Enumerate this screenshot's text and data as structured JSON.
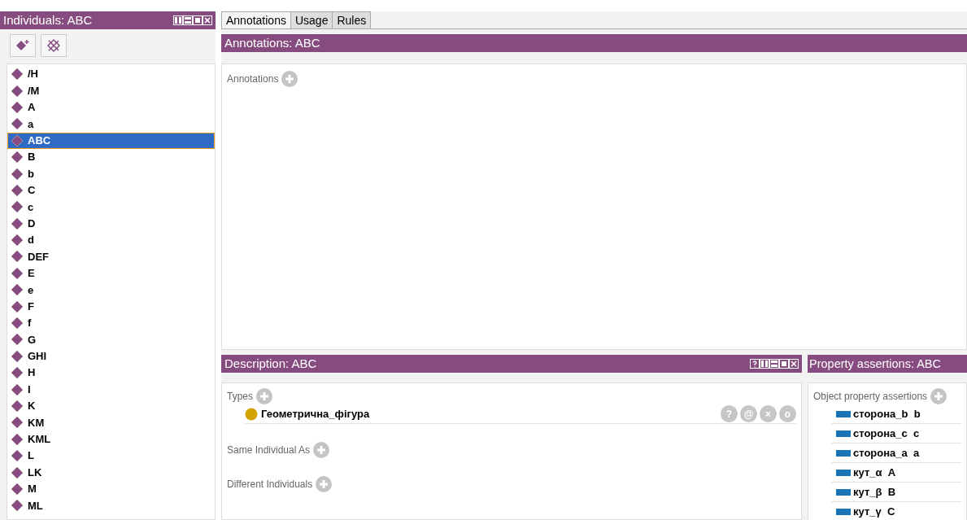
{
  "individuals_panel": {
    "title": "Individuals: ABC",
    "items": [
      {
        "label": "/H",
        "selected": false
      },
      {
        "label": "/M",
        "selected": false
      },
      {
        "label": "A",
        "selected": false
      },
      {
        "label": "a",
        "selected": false
      },
      {
        "label": "ABC",
        "selected": true
      },
      {
        "label": "B",
        "selected": false
      },
      {
        "label": "b",
        "selected": false
      },
      {
        "label": "C",
        "selected": false
      },
      {
        "label": "c",
        "selected": false
      },
      {
        "label": "D",
        "selected": false
      },
      {
        "label": "d",
        "selected": false
      },
      {
        "label": "DEF",
        "selected": false
      },
      {
        "label": "E",
        "selected": false
      },
      {
        "label": "e",
        "selected": false
      },
      {
        "label": "F",
        "selected": false
      },
      {
        "label": "f",
        "selected": false
      },
      {
        "label": "G",
        "selected": false
      },
      {
        "label": "GHI",
        "selected": false
      },
      {
        "label": "H",
        "selected": false
      },
      {
        "label": "I",
        "selected": false
      },
      {
        "label": "K",
        "selected": false
      },
      {
        "label": "KM",
        "selected": false
      },
      {
        "label": "KML",
        "selected": false
      },
      {
        "label": "L",
        "selected": false
      },
      {
        "label": "LK",
        "selected": false
      },
      {
        "label": "M",
        "selected": false
      },
      {
        "label": "ML",
        "selected": false
      }
    ]
  },
  "tabs": [
    {
      "label": "Annotations",
      "selected": true
    },
    {
      "label": "Usage",
      "selected": false
    },
    {
      "label": "Rules",
      "selected": false
    }
  ],
  "annotations_panel": {
    "title": "Annotations: ABC",
    "section": "Annotations"
  },
  "description_panel": {
    "title": "Description: ABC",
    "sections": [
      {
        "label": "Types",
        "items": [
          {
            "label": "Геометрична_фігура",
            "actions": [
              "?",
              "@",
              "×",
              "o"
            ]
          }
        ]
      },
      {
        "label": "Same Individual As"
      },
      {
        "label": "Different Individuals"
      }
    ]
  },
  "property_panel": {
    "title": "Property assertions: ABC",
    "section": "Object property assertions",
    "items": [
      {
        "property": "сторона_b",
        "value": "b"
      },
      {
        "property": "сторона_c",
        "value": "c"
      },
      {
        "property": "сторона_a",
        "value": "a"
      },
      {
        "property": "кут_α",
        "value": "A"
      },
      {
        "property": "кут_β",
        "value": "B"
      },
      {
        "property": "кут_γ",
        "value": "C"
      }
    ]
  }
}
